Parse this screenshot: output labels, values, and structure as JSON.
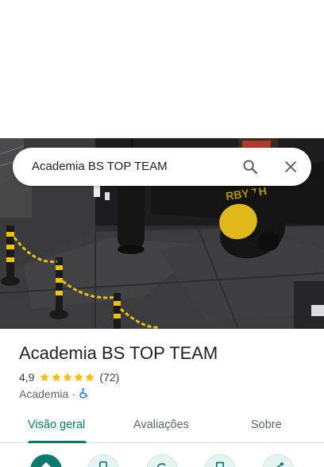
{
  "search": {
    "query": "Academia BS TOP TEAM",
    "search_icon": "search-icon",
    "close_icon": "close-icon"
  },
  "hero_image": {
    "subject": "gym-interior-photo"
  },
  "place": {
    "name": "Academia BS TOP TEAM",
    "rating": "4,9",
    "stars": 5,
    "review_count": "(72)",
    "category": "Academia",
    "separator": "·",
    "accessibility_icon": "wheelchair-accessible-icon"
  },
  "tabs": [
    {
      "label": "Visão geral",
      "active": true
    },
    {
      "label": "Avaliações",
      "active": false
    },
    {
      "label": "Sobre",
      "active": false
    }
  ],
  "actions": [
    {
      "icon": "directions-icon",
      "primary": true
    },
    {
      "icon": "phone-icon",
      "primary": false
    },
    {
      "icon": "rotate-icon",
      "primary": false
    },
    {
      "icon": "save-icon",
      "primary": false
    },
    {
      "icon": "share-icon",
      "primary": false
    }
  ],
  "colors": {
    "accent": "#00796b",
    "star": "#fbbc04",
    "accessibility": "#1a73e8"
  }
}
